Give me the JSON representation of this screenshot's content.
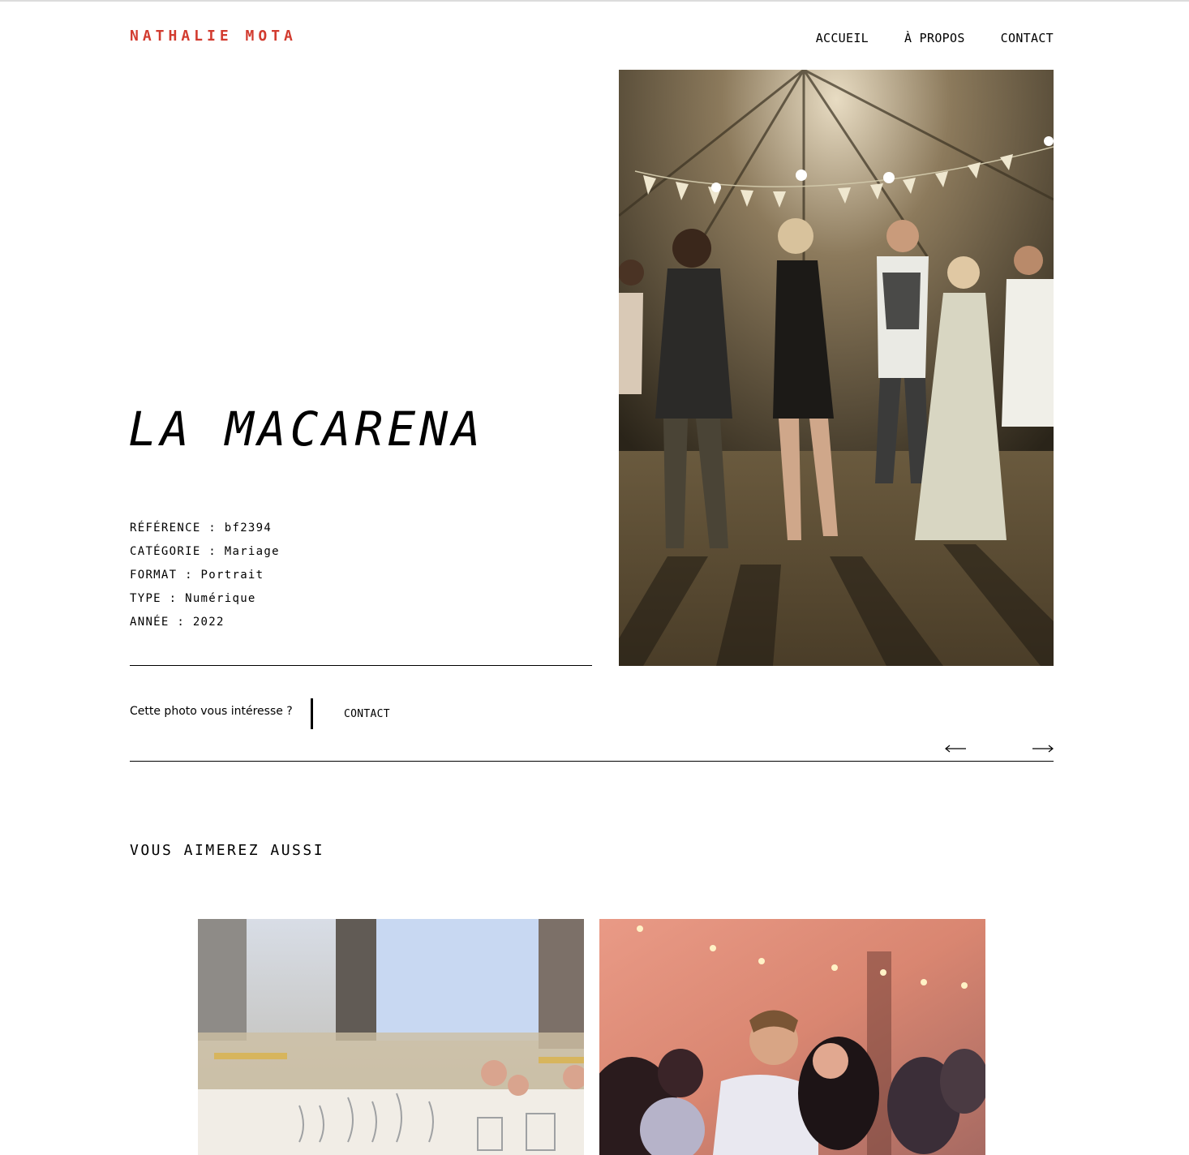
{
  "header": {
    "logo": "NATHALIE MOTA",
    "nav": [
      "ACCUEIL",
      "À PROPOS",
      "CONTACT"
    ]
  },
  "photo": {
    "title": "LA MACARENA",
    "meta": [
      "RÉFÉRENCE : bf2394",
      "CATÉGORIE : Mariage",
      "FORMAT : Portrait",
      "TYPE : Numérique",
      "ANNÉE : 2022"
    ]
  },
  "interest": {
    "question": "Cette photo vous intéresse ?",
    "contact_label": "CONTACT"
  },
  "navigation": {
    "prev_icon": "arrow-left-icon",
    "next_icon": "arrow-right-icon"
  },
  "related": {
    "title": "VOUS AIMEREZ AUSSI"
  },
  "colors": {
    "brand": "#d23b2f",
    "text": "#000000",
    "background": "#ffffff"
  }
}
